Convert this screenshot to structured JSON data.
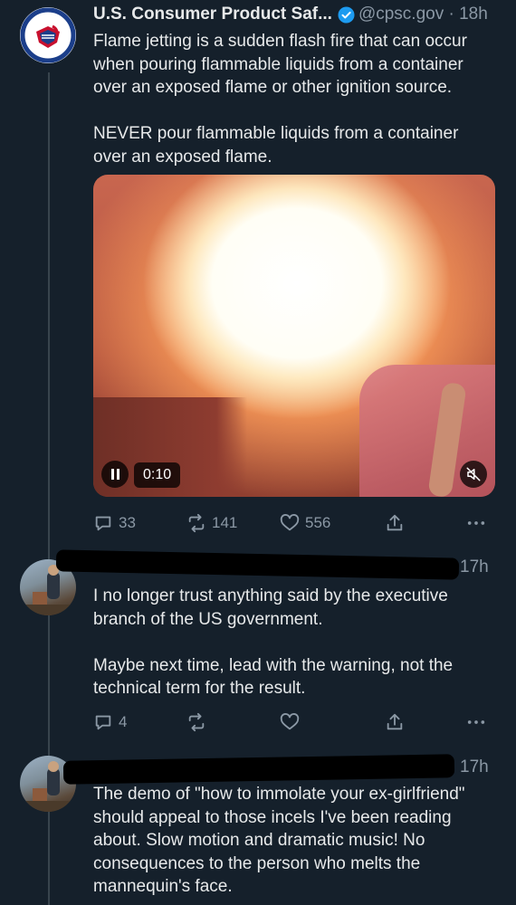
{
  "tweets": [
    {
      "author_name": "U.S. Consumer Product Saf...",
      "handle": "@cpsc.gov",
      "time": "18h",
      "text": "Flame jetting is a sudden flash fire that can occur when pouring flammable liquids from a container over an exposed flame or other ignition source.\n\nNEVER pour flammable liquids from a container over an exposed flame.",
      "video_time": "0:10",
      "video_state": "playing",
      "video_muted": true,
      "replies": "33",
      "reposts": "141",
      "likes": "556"
    },
    {
      "time": "17h",
      "text": "I no longer trust anything said by the executive branch of the US government.\n\nMaybe next time, lead with the warning, not the technical term for the result.",
      "replies": "4",
      "reposts": "",
      "likes": ""
    },
    {
      "time": "17h",
      "text": "The demo of \"how to immolate your ex-girlfriend\" should appeal to those incels I've been reading about. Slow motion and dramatic music! No consequences to the person who melts the mannequin's face."
    }
  ],
  "icons": {
    "verified": "verified-badge-icon",
    "reply": "reply-icon",
    "repost": "repost-icon",
    "like": "heart-icon",
    "share": "share-icon",
    "more": "more-icon",
    "pause": "pause-icon",
    "mute": "muted-speaker-icon"
  },
  "colors": {
    "background": "#15202b",
    "text": "#e7e9ea",
    "secondary_text": "#8b98a5",
    "verified": "#1d9bf0",
    "thread_line": "#38444d"
  }
}
